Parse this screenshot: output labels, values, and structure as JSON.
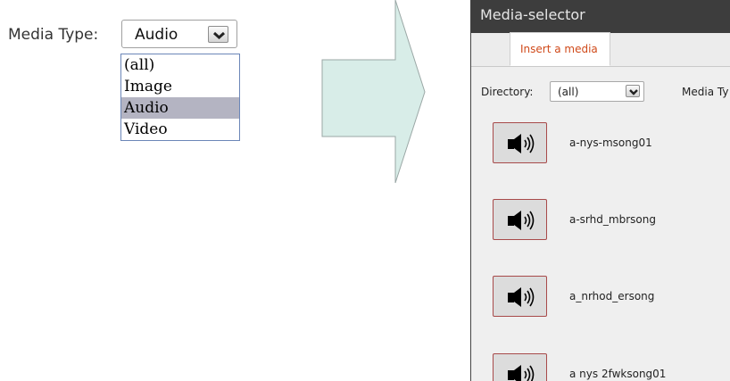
{
  "select_demo": {
    "label": "Media Type:",
    "selected_value": "Audio",
    "options": [
      "(all)",
      "Image",
      "Audio",
      "Video"
    ],
    "highlighted_option": "Audio",
    "dropdown_icon": "chevron-down-icon"
  },
  "arrow": {
    "fill": "#d8ede8",
    "stroke": "#9aa7a5",
    "icon": "right-arrow-icon"
  },
  "dialog": {
    "title": "Media-selector",
    "tab_label": "Insert a media",
    "tab_color": "#d04a1a",
    "directory_label": "Directory:",
    "directory_value": "(all)",
    "media_type_label": "Media Ty",
    "items": [
      {
        "name": "a-nys-msong01",
        "icon": "speaker-icon"
      },
      {
        "name": "a-srhd_mbrsong",
        "icon": "speaker-icon"
      },
      {
        "name": "a_nrhod_ersong",
        "icon": "speaker-icon"
      },
      {
        "name": "a nys 2fwksong01",
        "icon": "speaker-icon"
      }
    ]
  }
}
